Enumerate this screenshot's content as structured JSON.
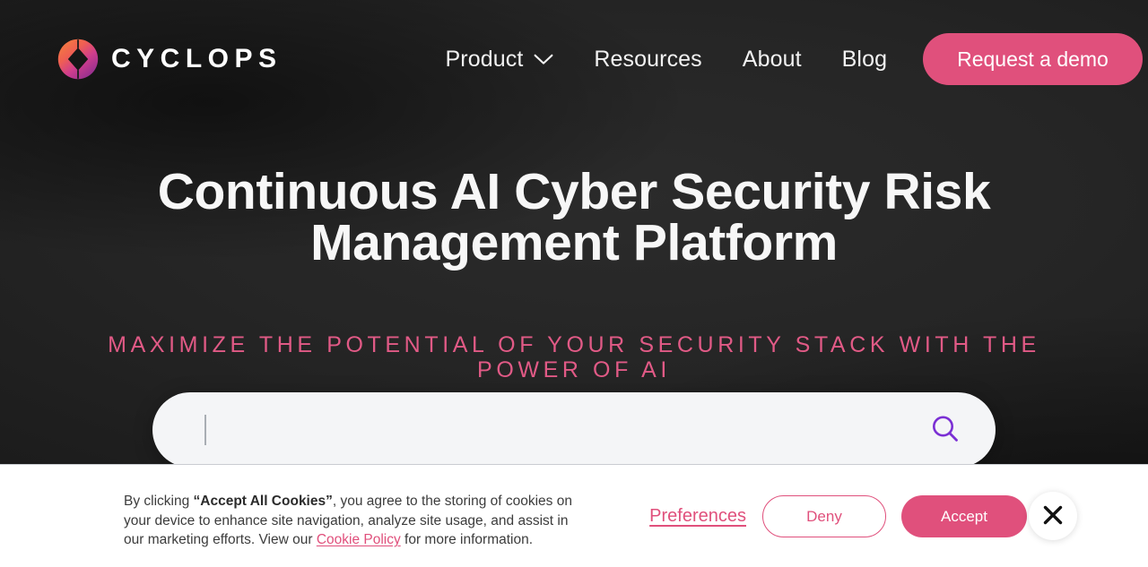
{
  "header": {
    "brand": {
      "name": "CYCLOPS",
      "logo_icon": "cyclops-logo-icon"
    },
    "nav": [
      {
        "label": "Product",
        "has_dropdown": true,
        "icon": "chevron-down-icon"
      },
      {
        "label": "Resources",
        "has_dropdown": false
      },
      {
        "label": "About",
        "has_dropdown": false
      },
      {
        "label": "Blog",
        "has_dropdown": false
      }
    ],
    "cta": {
      "label": "Request a demo"
    }
  },
  "hero": {
    "headline": "Continuous AI Cyber Security Risk Management Platform",
    "subheadline": "MAXIMIZE THE POTENTIAL OF YOUR SECURITY STACK WITH THE POWER OF AI",
    "search": {
      "value": "",
      "placeholder": "",
      "icon": "search-icon"
    }
  },
  "cookie_banner": {
    "text_part1": "By clicking ",
    "text_bold": "“Accept All Cookies”",
    "text_part2": ", you agree to the storing of cookies on your device to enhance site navigation, analyze site usage, and assist in our marketing efforts. View our ",
    "link_label": "Cookie Policy",
    "text_part3": " for more information.",
    "preferences_label": "Preferences",
    "deny_label": "Deny",
    "accept_label": "Accept",
    "close_icon": "close-icon"
  },
  "colors": {
    "brand_pink": "#e0507c",
    "search_icon_purple": "#7b2fd4",
    "hero_background": "#1d1d1d",
    "banner_background": "#ffffff"
  }
}
